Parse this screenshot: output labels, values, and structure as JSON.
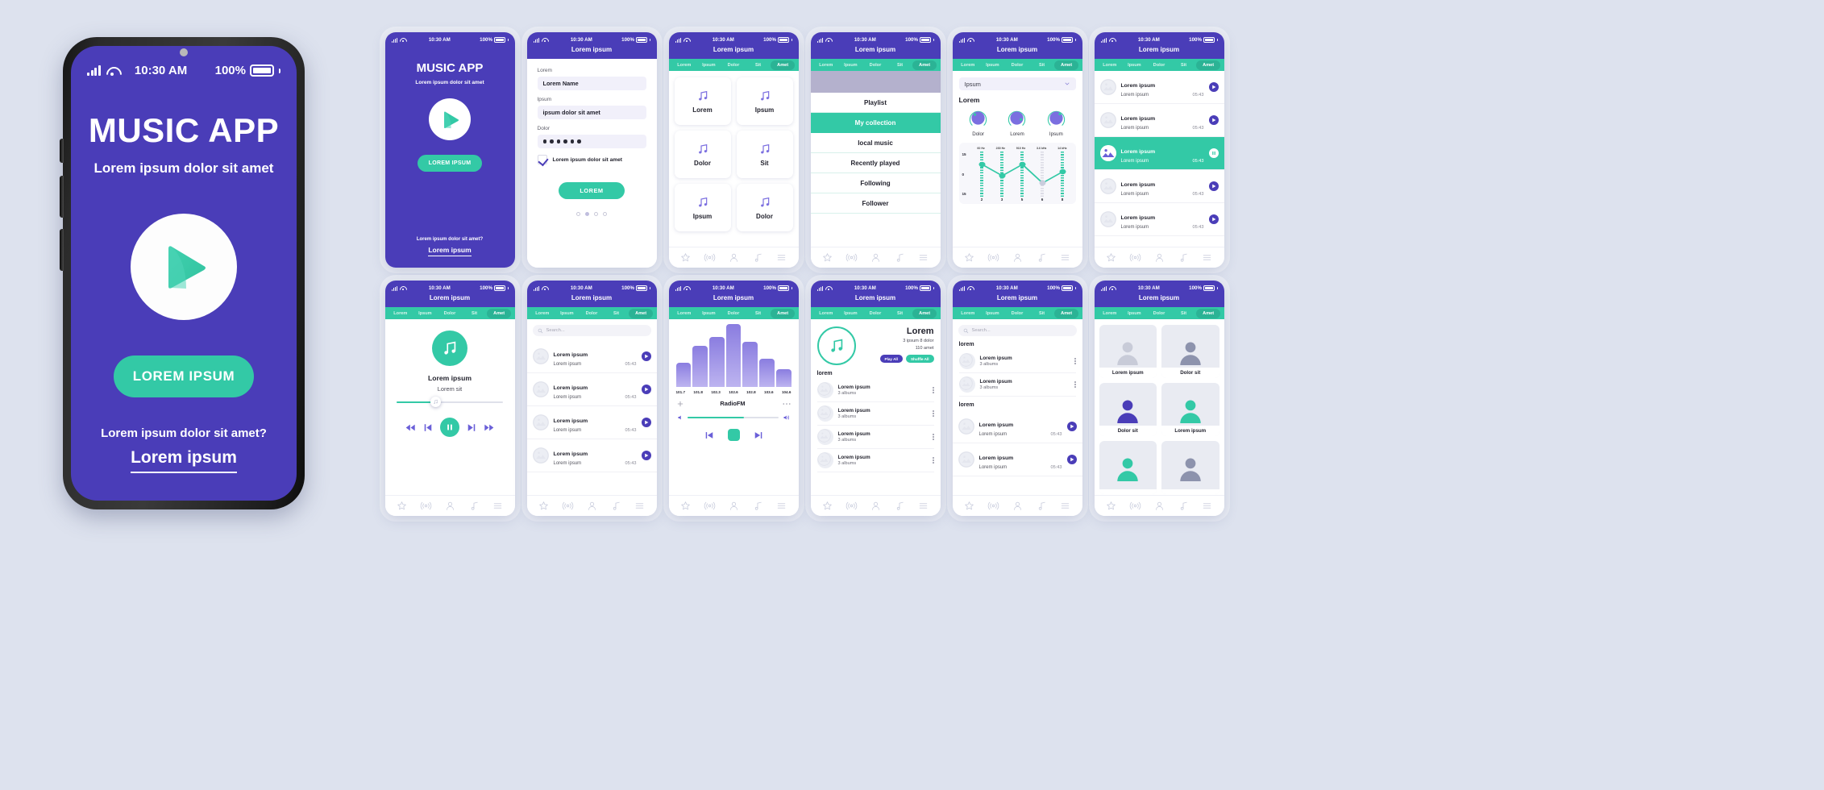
{
  "meta": {
    "bg_color": "#dde2ee",
    "purple": "#4a3db8",
    "teal": "#33c9a6",
    "screens_count": 12
  },
  "status": {
    "time": "10:30 AM",
    "battery": "100%"
  },
  "hero": {
    "title": "MUSIC APP",
    "subtitle": "Lorem ipsum dolor sit amet",
    "cta": "LOREM IPSUM",
    "footer_question": "Lorem ipsum dolor sit amet?",
    "footer_link": "Lorem ipsum"
  },
  "tabs": [
    "Lorem",
    "Ipsum",
    "Dolor",
    "Sit",
    "Amet"
  ],
  "header_title": "Lorem ipsum",
  "nav_icons": [
    "star-icon",
    "broadcast-icon",
    "person-icon",
    "music-note-icon",
    "menu-icon"
  ],
  "splash": {
    "title": "MUSIC APP",
    "subtitle": "Lorem ipsum dolor sit amet",
    "cta": "LOREM IPSUM",
    "footer_question": "Lorem ipsum dolor sit amet?",
    "footer_link": "Lorem ipsum"
  },
  "form": {
    "fields": [
      {
        "label": "Lorem",
        "value": "Lorem Name"
      },
      {
        "label": "Ipsum",
        "value": "ipsum dolor sit amet"
      },
      {
        "label": "Dolor",
        "value": "••••••",
        "masked": true
      }
    ],
    "checkbox_label": "Lorem ipsum dolor sit amet",
    "checkbox_checked": true,
    "submit": "LOREM",
    "pager": {
      "count": 4,
      "active_index": 1
    }
  },
  "genres": {
    "items": [
      "Lorem",
      "Ipsum",
      "Dolor",
      "Sit",
      "Ipsum",
      "Dolor"
    ]
  },
  "menu": {
    "items": [
      {
        "label": "Playlist",
        "active": false
      },
      {
        "label": "My collection",
        "active": true
      },
      {
        "label": "local music",
        "active": false
      },
      {
        "label": "Recently played",
        "active": false
      },
      {
        "label": "Following",
        "active": false
      },
      {
        "label": "Follower",
        "active": false
      }
    ]
  },
  "equalizer": {
    "select_value": "Ipsum",
    "section_title": "Lorem",
    "knobs": [
      {
        "label": "Dolor",
        "angle": -50
      },
      {
        "label": "Lorem",
        "angle": 55
      },
      {
        "label": "Ipsum",
        "angle": -30
      }
    ],
    "chart_data": {
      "type": "line",
      "title": "Lorem",
      "categories": [
        "60 Hz",
        "230 Hz",
        "910 Hz",
        "3.6 kHz",
        "14 kHz"
      ],
      "x_ticks": [
        "2",
        "3",
        "5",
        "6",
        "8"
      ],
      "y_ticks": [
        "15",
        "0",
        "15"
      ],
      "ylim": [
        -15,
        15
      ],
      "values": [
        8,
        1,
        8,
        -3,
        5
      ],
      "grid": false,
      "legend": "none",
      "xlabel": "",
      "ylabel": ""
    }
  },
  "tracklist": {
    "rows": [
      {
        "title": "Lorem ipsum",
        "subtitle": "Lorem ipsum",
        "duration": "05:43",
        "active": false
      },
      {
        "title": "Lorem ipsum",
        "subtitle": "Lorem ipsum",
        "duration": "05:43",
        "active": false
      },
      {
        "title": "Lorem ipsum",
        "subtitle": "Lorem ipsum",
        "duration": "05:43",
        "active": true
      },
      {
        "title": "Lorem ipsum",
        "subtitle": "Lorem ipsum",
        "duration": "05:43",
        "active": false
      },
      {
        "title": "Lorem ipsum",
        "subtitle": "Lorem ipsum",
        "duration": "05:43",
        "active": false
      }
    ]
  },
  "player": {
    "track_title": "Lorem ipsum",
    "track_artist": "Lorem sit",
    "controls": [
      "rewind-icon",
      "previous-icon",
      "pause-icon",
      "next-icon",
      "fastforward-icon"
    ]
  },
  "search": {
    "placeholder": "Search..."
  },
  "searchlist": {
    "rows": [
      {
        "title": "Lorem ipsum",
        "subtitle": "Lorem ipsum",
        "duration": "05:43"
      },
      {
        "title": "Lorem ipsum",
        "subtitle": "Lorem ipsum",
        "duration": "05:43"
      },
      {
        "title": "Lorem ipsum",
        "subtitle": "Lorem ipsum",
        "duration": "05:43"
      },
      {
        "title": "Lorem ipsum",
        "subtitle": "Lorem ipsum",
        "duration": "05:43"
      }
    ]
  },
  "radio": {
    "station_name": "RadioFM",
    "chart_data": {
      "type": "bar",
      "title": "RadioFM",
      "categories": [
        "101.7",
        "101.8",
        "102.3",
        "102.6",
        "102.8",
        "103.6",
        "104.6"
      ],
      "values": [
        38,
        66,
        80,
        100,
        72,
        45,
        28
      ],
      "ylim": [
        0,
        100
      ],
      "xlabel": "",
      "ylabel": "",
      "grid": false
    }
  },
  "album": {
    "name": "Lorem",
    "meta_line1": "3 ipsum  8 dolor",
    "meta_line2": "110 amet",
    "btn_play": "Play All",
    "btn_shuffle": "Shuffle All",
    "section_label": "lorem",
    "rows": [
      {
        "title": "Lorem ipsum",
        "subtitle": "3 albums"
      },
      {
        "title": "Lorem ipsum",
        "subtitle": "3 albums"
      },
      {
        "title": "Lorem ipsum",
        "subtitle": "3 albums"
      },
      {
        "title": "Lorem ipsum",
        "subtitle": "3 albums"
      }
    ]
  },
  "searchalbums": {
    "section1": "lorem",
    "section2": "lorem",
    "rows1": [
      {
        "title": "Lorem ipsum",
        "subtitle": "3 albums"
      },
      {
        "title": "Lorem ipsum",
        "subtitle": "3 albums"
      }
    ],
    "rows2": [
      {
        "title": "Lorem ipsum",
        "subtitle": "Lorem ipsum",
        "duration": "05:43"
      },
      {
        "title": "Lorem ipsum",
        "subtitle": "Lorem ipsum",
        "duration": "05:43"
      }
    ]
  },
  "artists": {
    "cells": [
      {
        "label": "Lorem ipsum",
        "color": "#c8cbd8"
      },
      {
        "label": "Dolor sit",
        "color": "#8d93ad"
      },
      {
        "label": "Dolor sit",
        "color": "#4a3db8"
      },
      {
        "label": "Lorem ipsum",
        "color": "#33c9a6"
      },
      {
        "label": "",
        "color": "#33c9a6"
      },
      {
        "label": "",
        "color": "#8d93ad"
      }
    ]
  }
}
